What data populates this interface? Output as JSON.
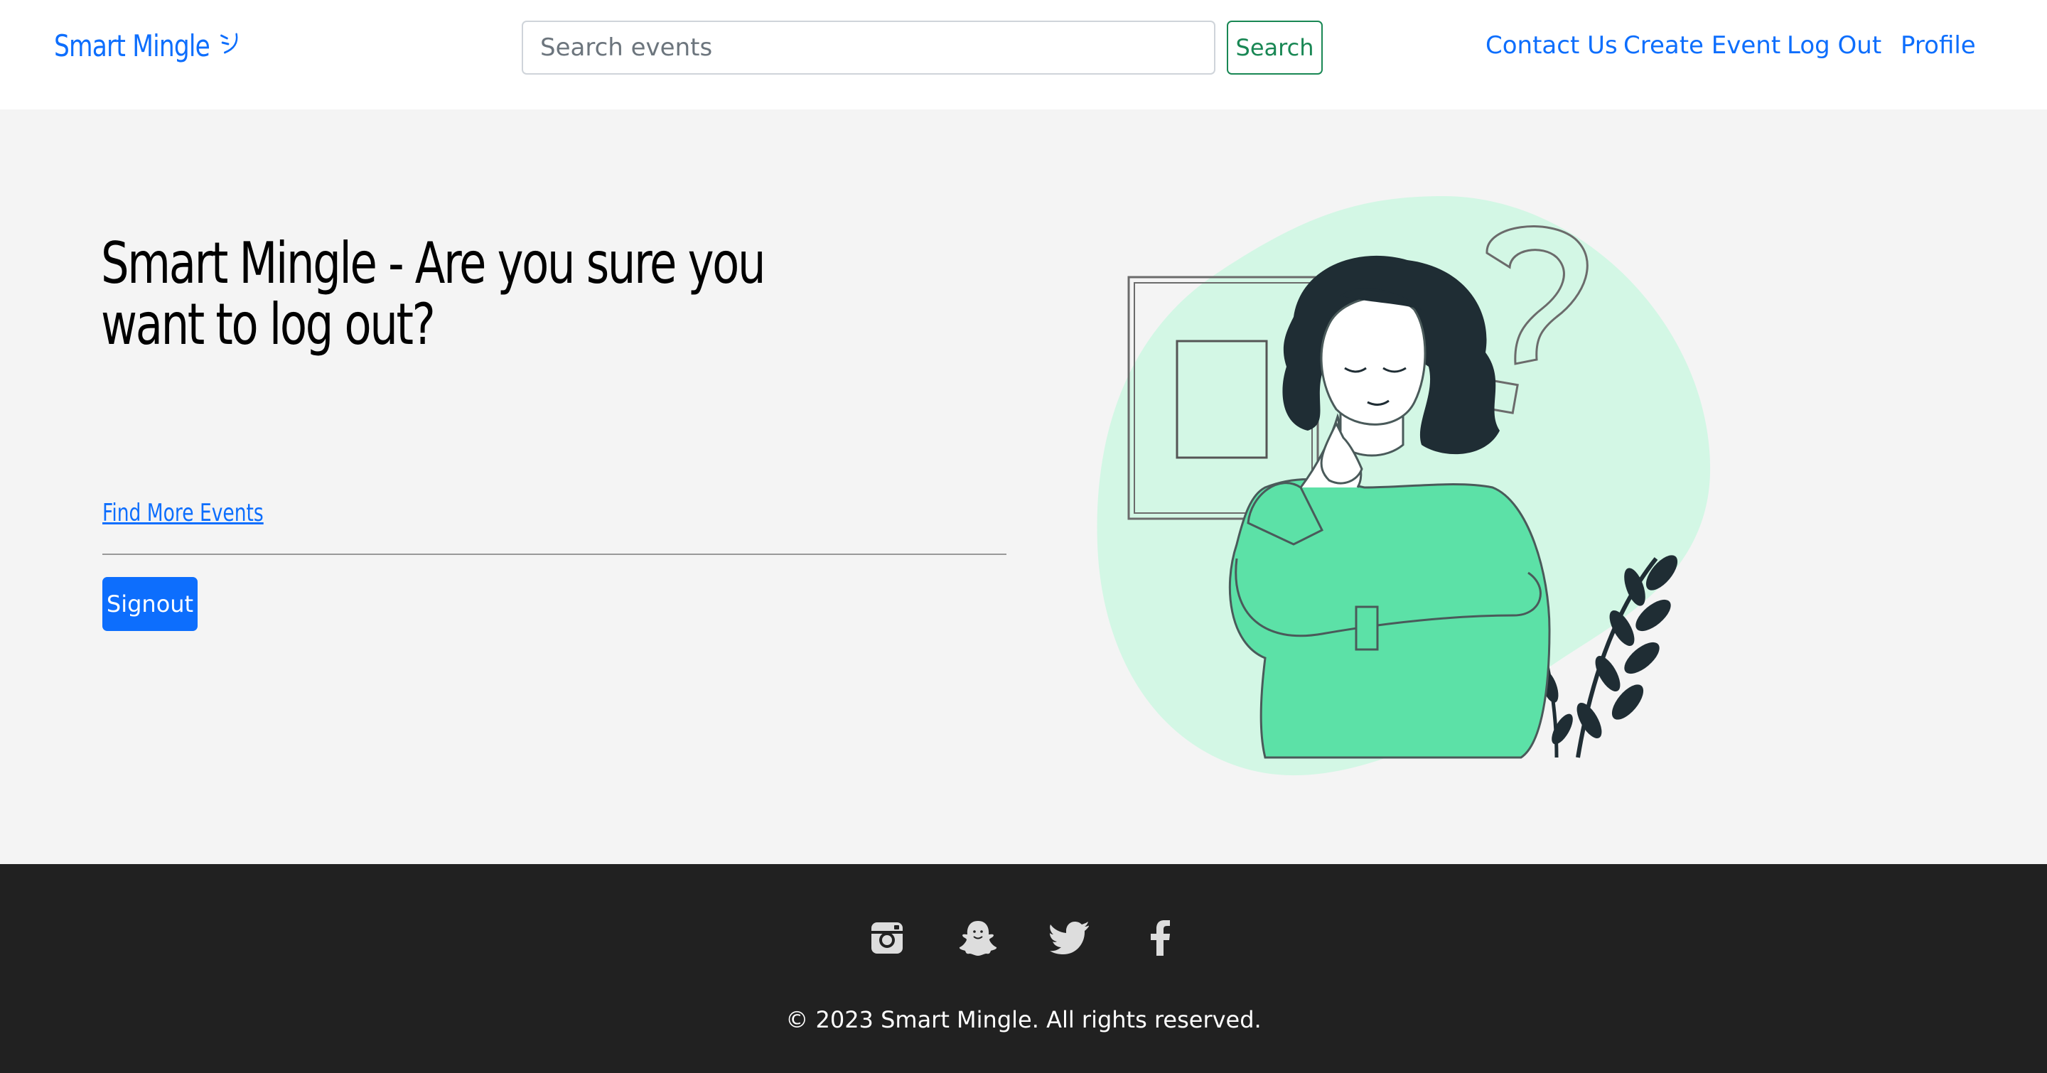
{
  "navbar": {
    "brand": "Smart Mingle",
    "brand_icon": "smile-icon",
    "search_placeholder": "Search events",
    "search_button": "Search",
    "links": [
      "Contact Us",
      "Create Event",
      "Log Out",
      "Profile"
    ]
  },
  "hero": {
    "title": "Smart Mingle - Are you sure you want to log out?",
    "find_link": "Find More Events",
    "signout_button": "Signout",
    "illustration": "thinking-woman-illustration"
  },
  "footer": {
    "social_icons": [
      "instagram-icon",
      "snapchat-icon",
      "twitter-icon",
      "facebook-icon"
    ],
    "copyright": "© 2023 Smart Mingle. All rights reserved."
  },
  "colors": {
    "primary": "#0d6efd",
    "success": "#198754",
    "accent_green": "#5ce1a7",
    "footer_bg": "#212121",
    "hero_bg": "#f4f4f4"
  }
}
